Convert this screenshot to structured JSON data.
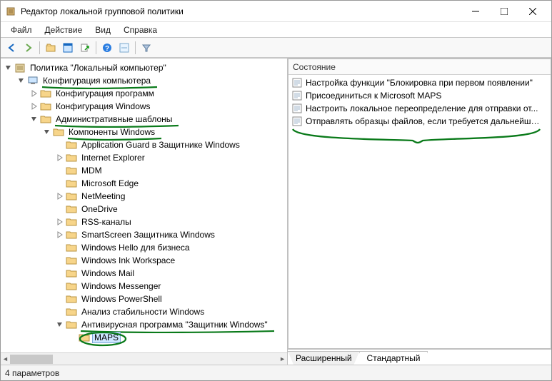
{
  "window": {
    "title": "Редактор локальной групповой политики"
  },
  "menubar": [
    "Файл",
    "Действие",
    "Вид",
    "Справка"
  ],
  "toolbar_icons": [
    "back",
    "forward",
    "up",
    "properties",
    "export",
    "refresh",
    "help",
    "list",
    "filter"
  ],
  "tree": {
    "root": {
      "label": "Политика \"Локальный компьютер\"",
      "expanded": true,
      "kind": "root"
    },
    "items": [
      {
        "label": "Конфигурация компьютера",
        "indent": 1,
        "expanded": true,
        "kind": "computer",
        "underline": true
      },
      {
        "label": "Конфигурация программ",
        "indent": 2,
        "kind": "folder",
        "exp": "closed"
      },
      {
        "label": "Конфигурация Windows",
        "indent": 2,
        "kind": "folder",
        "exp": "closed"
      },
      {
        "label": "Административные шаблоны",
        "indent": 2,
        "expanded": true,
        "kind": "folder",
        "underline": true
      },
      {
        "label": "Компоненты Windows",
        "indent": 3,
        "expanded": true,
        "kind": "folder",
        "underline": true
      },
      {
        "label": "Application Guard в Защитнике Windows",
        "indent": 4,
        "kind": "folder"
      },
      {
        "label": "Internet Explorer",
        "indent": 4,
        "kind": "folder",
        "exp": "closed"
      },
      {
        "label": "MDM",
        "indent": 4,
        "kind": "folder"
      },
      {
        "label": "Microsoft Edge",
        "indent": 4,
        "kind": "folder"
      },
      {
        "label": "NetMeeting",
        "indent": 4,
        "kind": "folder",
        "exp": "closed"
      },
      {
        "label": "OneDrive",
        "indent": 4,
        "kind": "folder"
      },
      {
        "label": "RSS-каналы",
        "indent": 4,
        "kind": "folder",
        "exp": "closed"
      },
      {
        "label": "SmartScreen Защитника Windows",
        "indent": 4,
        "kind": "folder",
        "exp": "closed"
      },
      {
        "label": "Windows Hello для бизнеса",
        "indent": 4,
        "kind": "folder"
      },
      {
        "label": "Windows Ink Workspace",
        "indent": 4,
        "kind": "folder"
      },
      {
        "label": "Windows Mail",
        "indent": 4,
        "kind": "folder"
      },
      {
        "label": "Windows Messenger",
        "indent": 4,
        "kind": "folder"
      },
      {
        "label": "Windows PowerShell",
        "indent": 4,
        "kind": "folder"
      },
      {
        "label": "Анализ стабильности Windows",
        "indent": 4,
        "kind": "folder"
      },
      {
        "label": "Антивирусная программа \"Защитник Windows\"",
        "indent": 4,
        "expanded": true,
        "kind": "folder",
        "underline": true
      },
      {
        "label": "MAPS",
        "indent": 5,
        "kind": "folder",
        "selected": true,
        "circle": true
      }
    ]
  },
  "list": {
    "header": "Состояние",
    "items": [
      "Настройка функции \"Блокировка при первом появлении\"",
      "Присоединиться к Microsoft MAPS",
      "Настроить локальное переопределение для отправки от...",
      "Отправлять образцы файлов, если требуется дальнейши..."
    ]
  },
  "tabs": {
    "items": [
      "Расширенный",
      "Стандартный"
    ],
    "active": 1
  },
  "statusbar": "4 параметров"
}
